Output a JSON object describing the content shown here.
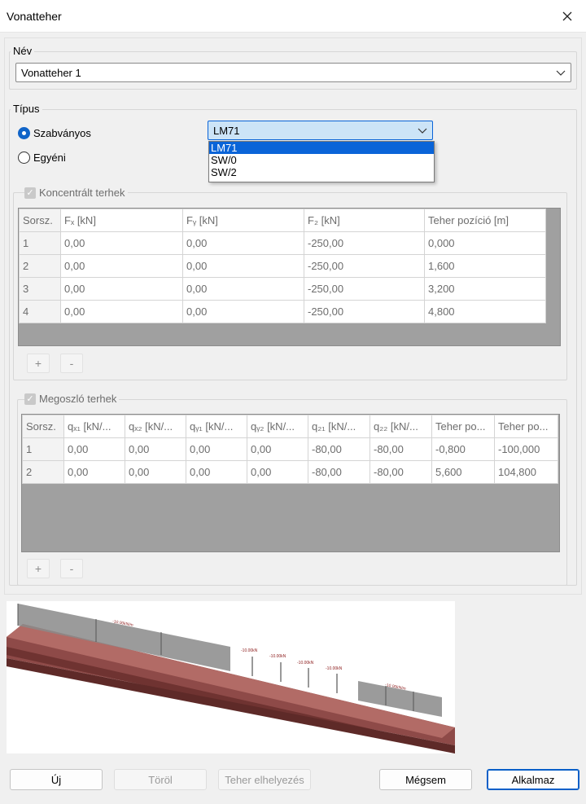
{
  "window": {
    "title": "Vonatteher",
    "close_icon": "close-icon"
  },
  "name_group": {
    "label": "Név",
    "value": "Vonatteher 1"
  },
  "type_group": {
    "label": "Típus",
    "radio_standard": "Szabványos",
    "radio_custom": "Egyéni",
    "standard_value": "LM71",
    "dropdown_options": [
      "LM71",
      "SW/0",
      "SW/2"
    ],
    "dropdown_selected_index": 0
  },
  "concentrated": {
    "label": "Koncentrált terhek",
    "headers": [
      "Sorsz.",
      "Fₓ [kN]",
      "Fᵧ [kN]",
      "F₂ [kN]",
      "Teher pozíció [m]"
    ],
    "rows": [
      [
        "1",
        "0,00",
        "0,00",
        "-250,00",
        "0,000"
      ],
      [
        "2",
        "0,00",
        "0,00",
        "-250,00",
        "1,600"
      ],
      [
        "3",
        "0,00",
        "0,00",
        "-250,00",
        "3,200"
      ],
      [
        "4",
        "0,00",
        "0,00",
        "-250,00",
        "4,800"
      ]
    ],
    "add_label": "+",
    "remove_label": "-"
  },
  "distributed": {
    "label": "Megoszló terhek",
    "headers": [
      "Sorsz.",
      "qₓ₁ [kN/...",
      "qₓ₂ [kN/...",
      "qᵧ₁ [kN/...",
      "qᵧ₂ [kN/...",
      "q₂₁ [kN/...",
      "q₂₂ [kN/...",
      "Teher po...",
      "Teher po..."
    ],
    "rows": [
      [
        "1",
        "0,00",
        "0,00",
        "0,00",
        "0,00",
        "-80,00",
        "-80,00",
        "-0,800",
        "-100,000"
      ],
      [
        "2",
        "0,00",
        "0,00",
        "0,00",
        "0,00",
        "-80,00",
        "-80,00",
        "5,600",
        "104,800"
      ]
    ],
    "add_label": "+",
    "remove_label": "-"
  },
  "preview": {
    "dist_label_1": "-10.00kN/m",
    "dist_label_2": "-10.00kN/m",
    "point_labels": [
      "-10.00kN",
      "-10.00kN",
      "-10.00kN",
      "-10.00kN"
    ]
  },
  "buttons": {
    "new": "Új",
    "delete": "Töröl",
    "place": "Teher elhelyezés",
    "cancel": "Mégsem",
    "apply": "Alkalmaz"
  }
}
